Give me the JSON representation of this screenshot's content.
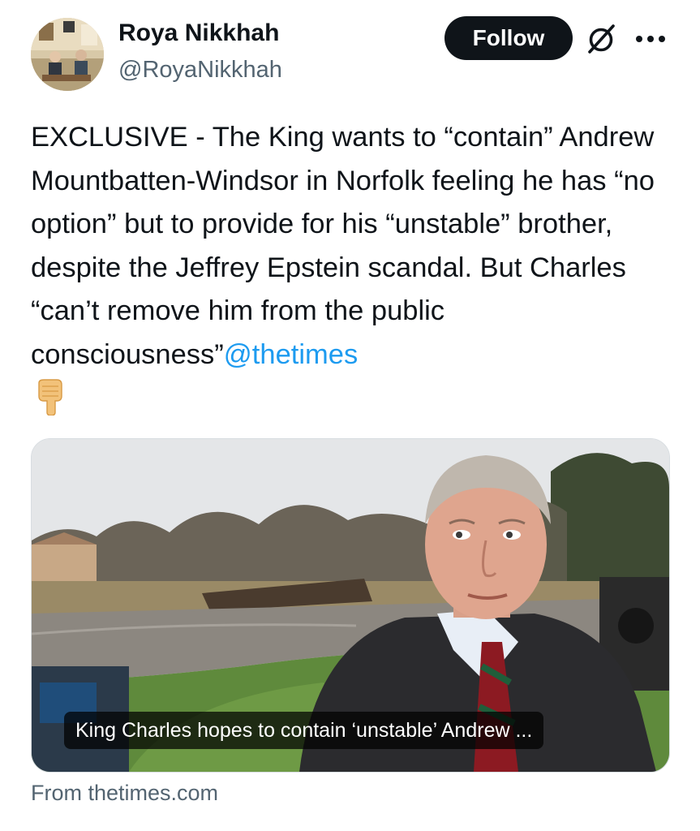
{
  "author": {
    "display_name": "Roya Nikkhah",
    "handle": "@RoyaNikkhah",
    "avatar_icon": "profile-photo"
  },
  "actions": {
    "follow_label": "Follow",
    "grok_icon": "grok-icon",
    "more_icon": "more-dots-icon"
  },
  "tweet": {
    "text": "EXCLUSIVE - The King wants to “contain” Andrew Mountbatten-Windsor in Norfolk feeling he has “no option” but to provide for his “unstable” brother, despite the Jeffrey Epstein scandal. But Charles “can’t remove him from the public consciousness”",
    "mention": "@thetimes",
    "emoji": "👇",
    "emoji_icon": "backhand-index-pointing-down"
  },
  "card": {
    "caption": "King Charles hopes to contain ‘unstable’ Andrew ...",
    "source": "From thetimes.com",
    "image_description_icon": "news-photo"
  },
  "colors": {
    "text": "#0f1419",
    "secondary": "#536471",
    "link": "#1d9bf0",
    "button_bg": "#0f1419",
    "button_text": "#ffffff"
  }
}
